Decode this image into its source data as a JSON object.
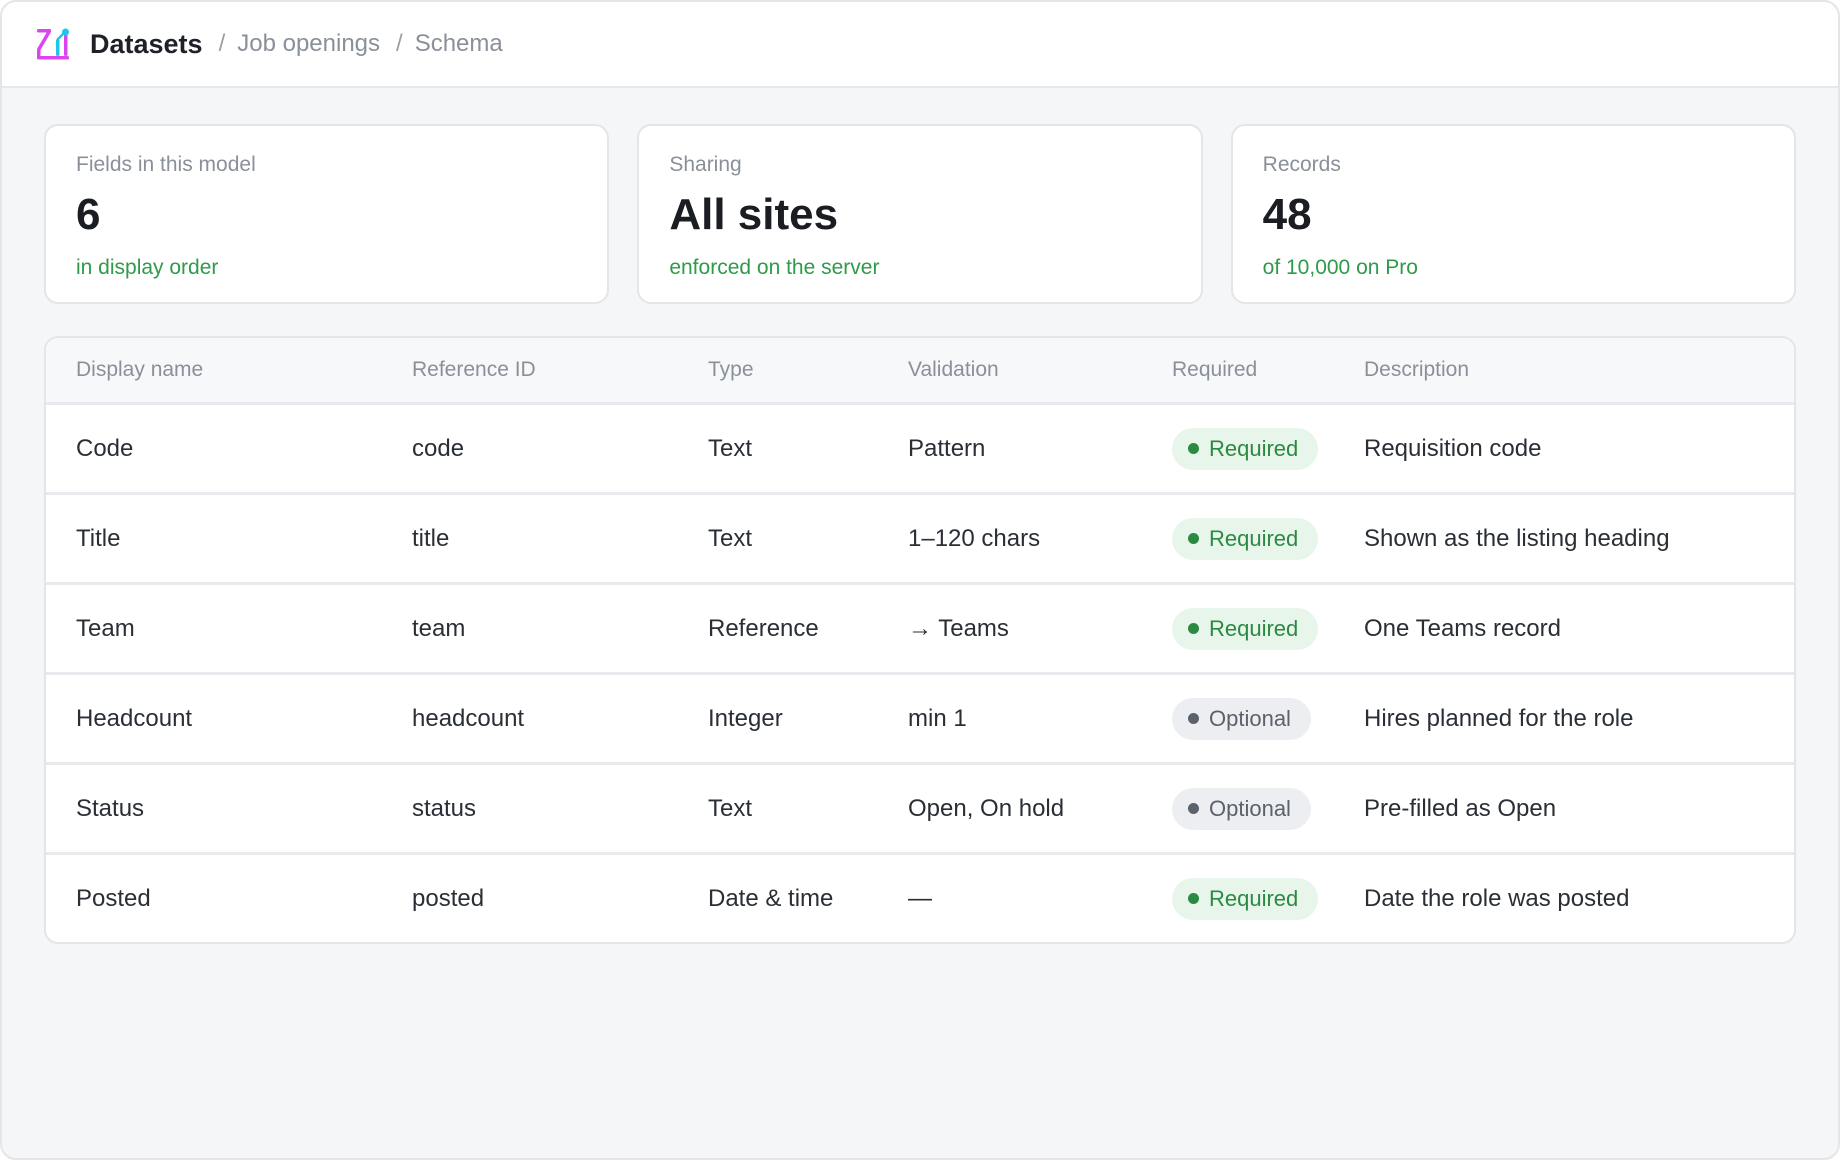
{
  "header": {
    "app_title": "Datasets",
    "breadcrumb": [
      "Job openings",
      "Schema"
    ],
    "separator": "/"
  },
  "stats": [
    {
      "label": "Fields in this model",
      "value": "6",
      "note": "in display order"
    },
    {
      "label": "Sharing",
      "value": "All sites",
      "note": "enforced on the server"
    },
    {
      "label": "Records",
      "value": "48",
      "note": "of 10,000 on Pro"
    }
  ],
  "table": {
    "columns": [
      "Display name",
      "Reference ID",
      "Type",
      "Validation",
      "Required",
      "Description"
    ],
    "rows": [
      {
        "name": "Code",
        "ref": "code",
        "type": "Text",
        "validation": "Pattern",
        "required": "Required",
        "description": "Requisition code"
      },
      {
        "name": "Title",
        "ref": "title",
        "type": "Text",
        "validation": "1–120 chars",
        "required": "Required",
        "description": "Shown as the listing heading"
      },
      {
        "name": "Team",
        "ref": "team",
        "type": "Reference",
        "validation": "→ Teams",
        "required": "Required",
        "description": "One Teams record"
      },
      {
        "name": "Headcount",
        "ref": "headcount",
        "type": "Integer",
        "validation": "min 1",
        "required": "Optional",
        "description": "Hires planned for the role"
      },
      {
        "name": "Status",
        "ref": "status",
        "type": "Text",
        "validation": "Open, On hold",
        "required": "Optional",
        "description": "Pre-filled as Open"
      },
      {
        "name": "Posted",
        "ref": "posted",
        "type": "Date & time",
        "validation": "—",
        "required": "Required",
        "description": "Date the role was posted"
      }
    ]
  },
  "colors": {
    "accent_green": "#2f9a4a",
    "badge_required_bg": "#e7f5ea",
    "badge_optional_bg": "#eceef1",
    "logo_magenta": "#d946ef",
    "logo_cyan": "#22c5e8"
  },
  "icons": {
    "logo": "datasets-logo-icon"
  }
}
